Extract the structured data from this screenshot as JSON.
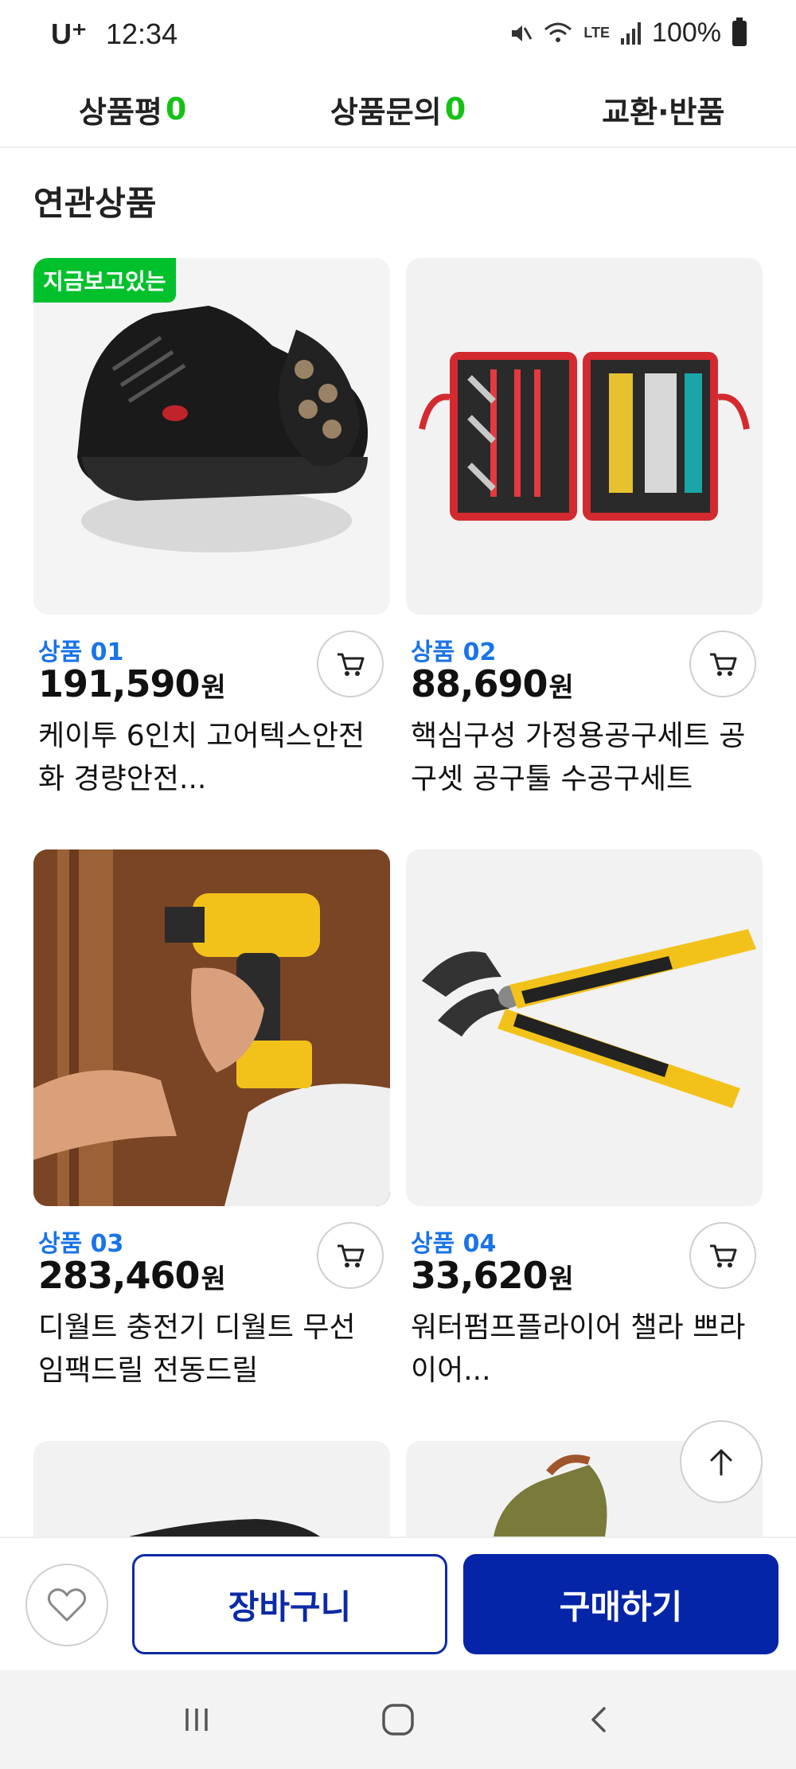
{
  "status_bar": {
    "carrier": "U⁺",
    "time": "12:34",
    "network": "LTE",
    "battery": "100%"
  },
  "tabs": [
    {
      "label": "상품평",
      "count": "0"
    },
    {
      "label": "상품문의",
      "count": "0"
    },
    {
      "label": "교환·반품"
    }
  ],
  "section_title": "연관상품",
  "products": [
    {
      "code": "상품 01",
      "price": "191,590",
      "currency": "원",
      "name": "케이투 6인치 고어텍스안전화 경량안전...",
      "badge": "지금보고있는",
      "image": "black-safety-shoe"
    },
    {
      "code": "상품 02",
      "price": "88,690",
      "currency": "원",
      "name": "핵심구성 가정용공구세트 공구셋 공구툴 수공구세트",
      "image": "red-tool-case"
    },
    {
      "code": "상품 03",
      "price": "283,460",
      "currency": "원",
      "name": "디월트 충전기 디월트 무선 임팩드릴 전동드릴",
      "image": "yellow-drill"
    },
    {
      "code": "상품 04",
      "price": "33,620",
      "currency": "원",
      "name": "워터펌프플라이어 챌라 쁘라이어...",
      "image": "water-pump-plier"
    }
  ],
  "actions": {
    "cart_label": "장바구니",
    "buy_label": "구매하기"
  },
  "colors": {
    "accent": "#0525a8",
    "badge": "#00c02c",
    "code_blue": "#1a73e8",
    "count_green": "#16c116"
  }
}
